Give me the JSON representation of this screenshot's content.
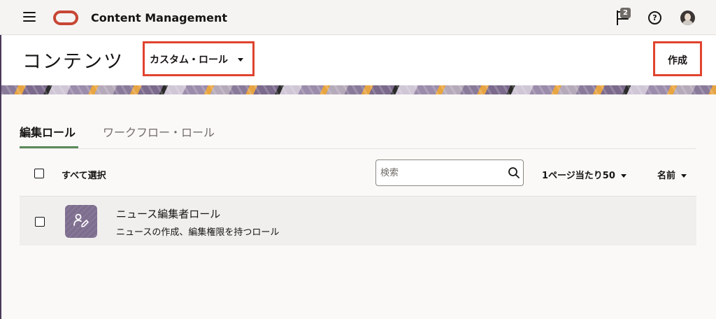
{
  "app": {
    "title": "Content Management",
    "notification_count": "2",
    "help_symbol": "?"
  },
  "header": {
    "page_title": "コンテンツ",
    "role_dropdown_label": "カスタム・ロール",
    "create_label": "作成"
  },
  "tabs": [
    {
      "label": "編集ロール",
      "active": true
    },
    {
      "label": "ワークフロー・ロール",
      "active": false
    }
  ],
  "toolbar": {
    "select_all_label": "すべて選択",
    "search_placeholder": "検索",
    "page_size_label": "1ページ当たり50",
    "sort_label": "名前"
  },
  "roles": [
    {
      "name": "ニュース編集者ロール",
      "description": "ニュースの作成、編集権限を持つロール",
      "icon": "user-edit-icon"
    }
  ],
  "colors": {
    "accent_red": "#c74634",
    "highlight_border": "#e0432f",
    "active_tab_underline": "#5b8a5b",
    "role_icon_bg": "#7d6d8e"
  }
}
